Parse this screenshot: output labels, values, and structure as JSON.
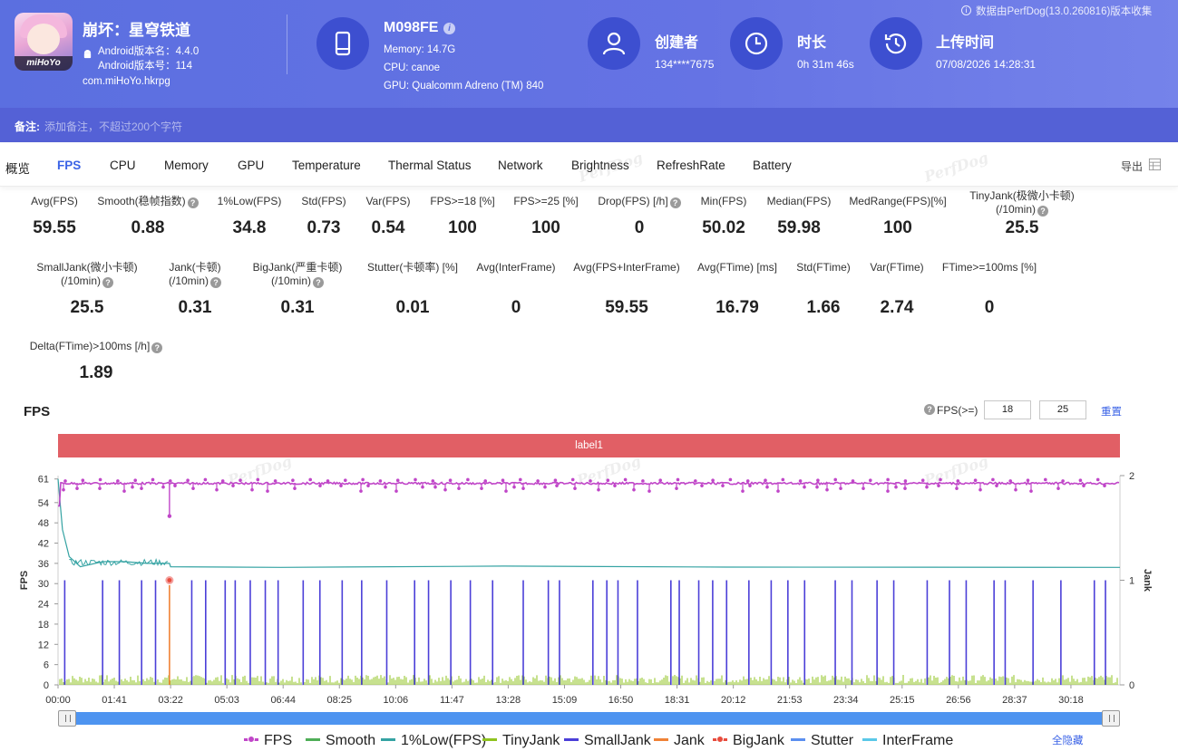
{
  "header": {
    "app_name": "崩坏：星穹铁道",
    "app_icon_text": "miHoYo",
    "android_version_name": "Android版本名：4.4.0",
    "android_version_code": "Android版本号：114",
    "package": "com.miHoYo.hkrpg",
    "device_model": "M098FE",
    "memory": "Memory: 14.7G",
    "cpu": "CPU: canoe",
    "gpu": "GPU: Qualcomm Adreno (TM) 840",
    "creator_label": "创建者",
    "creator_value": "134****7675",
    "duration_label": "时长",
    "duration_value": "0h 31m 46s",
    "upload_label": "上传时间",
    "upload_value": "07/08/2026 14:28:31",
    "data_note": "数据由PerfDog(13.0.260816)版本收集",
    "note_label": "备注:",
    "note_placeholder": "添加备注，不超过200个字符"
  },
  "tabs": [
    "概览",
    "FPS",
    "CPU",
    "Memory",
    "GPU",
    "Temperature",
    "Thermal Status",
    "Network",
    "Brightness",
    "RefreshRate",
    "Battery"
  ],
  "active_tab": "FPS",
  "export_label": "导出",
  "watermark": "PerfDog",
  "metrics": {
    "row1": [
      {
        "label": "Avg(FPS)",
        "value": "59.55"
      },
      {
        "label": "Smooth(稳帧指数)",
        "value": "0.88"
      },
      {
        "label": "1%Low(FPS)",
        "value": "34.8"
      },
      {
        "label": "Std(FPS)",
        "value": "0.73"
      },
      {
        "label": "Var(FPS)",
        "value": "0.54"
      },
      {
        "label": "FPS>=18 [%]",
        "value": "100"
      },
      {
        "label": "FPS>=25 [%]",
        "value": "100"
      },
      {
        "label": "Drop(FPS) [/h]",
        "value": "0"
      },
      {
        "label": "Min(FPS)",
        "value": "50.02"
      },
      {
        "label": "Median(FPS)",
        "value": "59.98"
      },
      {
        "label": "MedRange(FPS)[%]",
        "value": "100"
      },
      {
        "label": "TinyJank(极微小卡顿)",
        "label2": "(/10min)",
        "value": "25.5"
      }
    ],
    "row2": [
      {
        "label": "SmallJank(微小卡顿)",
        "label2": "(/10min)",
        "value": "25.5"
      },
      {
        "label": "Jank(卡顿)",
        "label2": "(/10min)",
        "value": "0.31"
      },
      {
        "label": "BigJank(严重卡顿)",
        "label2": "(/10min)",
        "value": "0.31"
      },
      {
        "label": "Stutter(卡顿率) [%]",
        "value": "0.01"
      },
      {
        "label": "Avg(InterFrame)",
        "value": "0"
      },
      {
        "label": "Avg(FPS+InterFrame)",
        "value": "59.55"
      },
      {
        "label": "Avg(FTime) [ms]",
        "value": "16.79"
      },
      {
        "label": "Std(FTime)",
        "value": "1.66"
      },
      {
        "label": "Var(FTime)",
        "value": "2.74"
      },
      {
        "label": "FTime>=100ms [%]",
        "value": "0"
      }
    ],
    "row3": [
      {
        "label": "Delta(FTime)>100ms [/h]",
        "value": "1.89"
      }
    ]
  },
  "fps_section": {
    "title": "FPS",
    "threshold_label": "FPS(>=)",
    "threshold_1": "18",
    "threshold_2": "25",
    "reset_label": "重置",
    "band_label": "label1",
    "hide_all": "全隐藏"
  },
  "chart_data": {
    "type": "line",
    "title": "",
    "ylabel": "FPS",
    "ylabel_right": "Jank",
    "y_ticks": [
      0,
      6,
      12,
      18,
      24,
      30,
      36,
      42,
      48,
      54,
      61
    ],
    "y_right_ticks": [
      0,
      1,
      2
    ],
    "ylim": [
      0,
      61
    ],
    "ylim_right": [
      0,
      2
    ],
    "x_ticks": [
      "00:00",
      "01:41",
      "03:22",
      "05:03",
      "06:44",
      "08:25",
      "10:06",
      "11:47",
      "13:28",
      "15:09",
      "16:50",
      "18:31",
      "20:12",
      "21:53",
      "23:34",
      "25:15",
      "26:56",
      "28:37",
      "30:18"
    ],
    "duration_seconds": 1906,
    "series": [
      {
        "name": "FPS",
        "color": "#c046c8",
        "approx_value": 60,
        "min_point": {
          "t": 200,
          "v": 50
        }
      },
      {
        "name": "Smooth",
        "color": "#4fae57"
      },
      {
        "name": "1%Low(FPS)",
        "color": "#35a3a3",
        "points": [
          [
            0,
            61
          ],
          [
            8,
            46
          ],
          [
            20,
            38
          ],
          [
            40,
            35
          ],
          [
            80,
            36.5
          ],
          [
            120,
            36.5
          ],
          [
            160,
            36
          ],
          [
            200,
            36
          ],
          [
            202,
            35
          ],
          [
            400,
            34.8
          ],
          [
            800,
            35.2
          ],
          [
            1200,
            34.9
          ],
          [
            1906,
            34.8
          ]
        ]
      },
      {
        "name": "TinyJank",
        "color": "#8fc31f"
      },
      {
        "name": "SmallJank",
        "color": "#4b3fd8",
        "spike_times": [
          12,
          80,
          110,
          150,
          175,
          240,
          265,
          300,
          318,
          345,
          372,
          395,
          440,
          470,
          510,
          545,
          590,
          640,
          665,
          705,
          740,
          780,
          835,
          880,
          900,
          960,
          985,
          1005,
          1040,
          1100,
          1115,
          1150,
          1175,
          1200,
          1240,
          1280,
          1310,
          1340,
          1395,
          1425,
          1470,
          1500,
          1560,
          1600,
          1630,
          1680,
          1700,
          1750,
          1800,
          1860,
          1880
        ]
      },
      {
        "name": "Jank",
        "color": "#f08236",
        "spike_times": [
          200
        ]
      },
      {
        "name": "BigJank",
        "color": "#e84c3d",
        "spike_times": [
          200
        ]
      },
      {
        "name": "Stutter",
        "color": "#5b8ff0"
      },
      {
        "name": "InterFrame",
        "color": "#5ac8e8"
      }
    ]
  }
}
